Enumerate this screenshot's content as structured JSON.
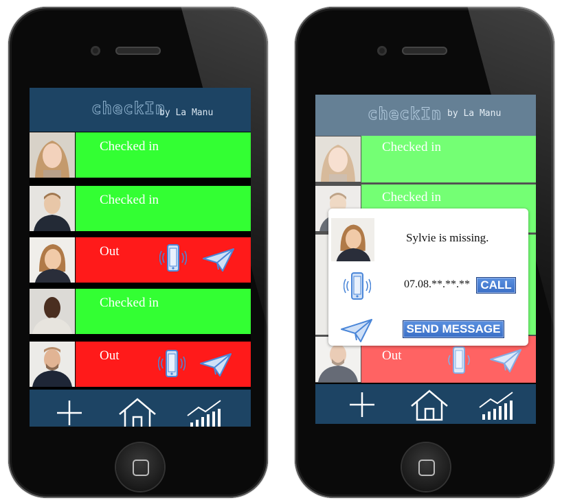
{
  "app": {
    "logo_text": "checkIn",
    "byline": "by La Manu"
  },
  "left_phone": {
    "rows": [
      {
        "status": "Checked  in",
        "state": "in"
      },
      {
        "status": "Checked  in",
        "state": "in"
      },
      {
        "status": "Out",
        "state": "out"
      },
      {
        "status": "Checked  in",
        "state": "in"
      },
      {
        "status": "Out",
        "state": "out"
      }
    ]
  },
  "right_phone": {
    "rows": [
      {
        "status": "Checked  in",
        "state": "in"
      },
      {
        "status": "Checked  in",
        "state": "in"
      },
      {
        "status": "Out",
        "state": "out"
      }
    ],
    "modal": {
      "title": "Sylvie  is  missing.",
      "phone_number": "07.08.**.**.**",
      "call_label": "CALL",
      "send_label": "SEND MESSAGE"
    }
  },
  "footer": {
    "icons": [
      "plus-icon",
      "home-icon",
      "stats-icon"
    ]
  },
  "colors": {
    "header_blue": "#1d4464",
    "checked_in_green": "#33ff33",
    "out_red": "#ff1a1a",
    "icon_blue": "#4a86d8"
  }
}
